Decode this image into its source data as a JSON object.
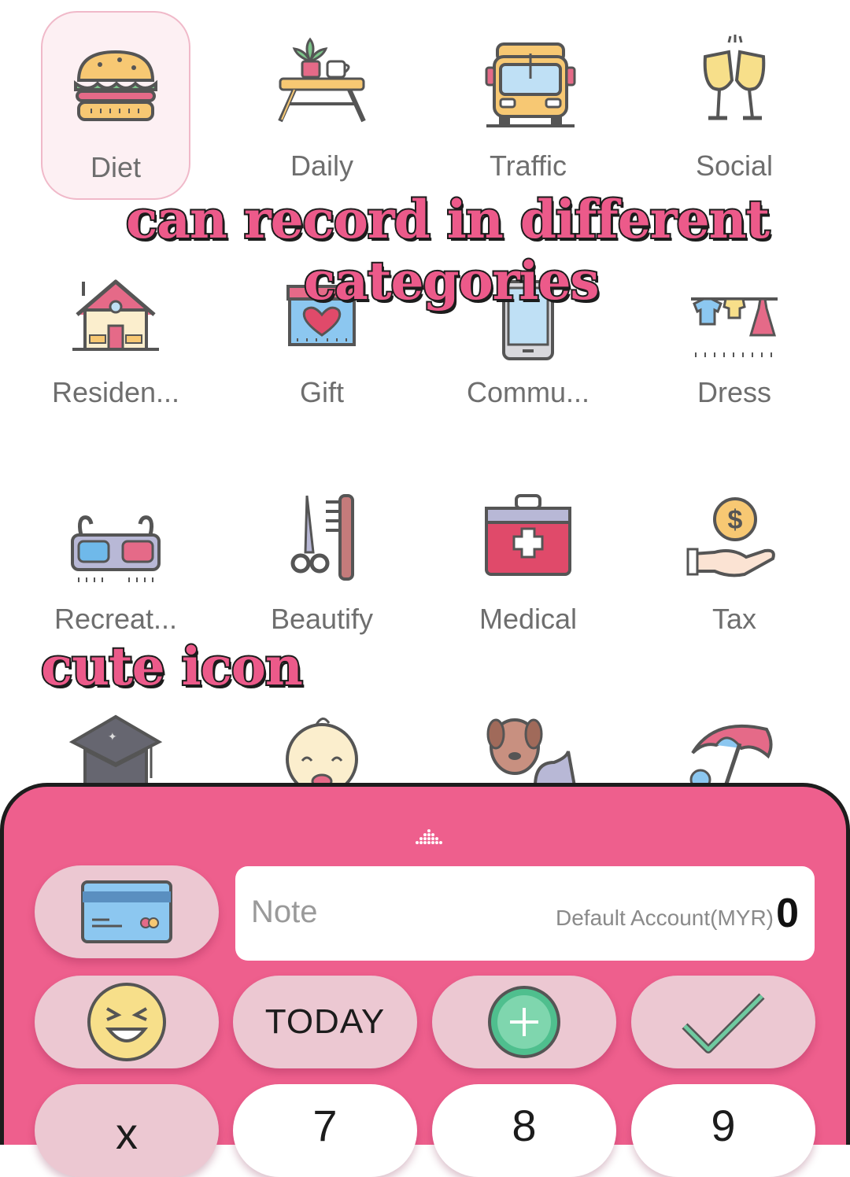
{
  "categories": [
    {
      "label": "Diet",
      "icon": "burger-icon",
      "selected": true
    },
    {
      "label": "Daily",
      "icon": "table-plant-icon"
    },
    {
      "label": "Traffic",
      "icon": "bus-icon"
    },
    {
      "label": "Social",
      "icon": "cheers-icon"
    },
    {
      "label": "Residen...",
      "icon": "house-icon"
    },
    {
      "label": "Gift",
      "icon": "gift-heart-icon"
    },
    {
      "label": "Commu...",
      "icon": "phone-icon"
    },
    {
      "label": "Dress",
      "icon": "clothesline-icon"
    },
    {
      "label": "Recreat...",
      "icon": "3d-glasses-icon"
    },
    {
      "label": "Beautify",
      "icon": "scissors-comb-icon"
    },
    {
      "label": "Medical",
      "icon": "first-aid-kit-icon"
    },
    {
      "label": "Tax",
      "icon": "coin-hand-icon"
    },
    {
      "label": "",
      "icon": "graduation-cap-icon"
    },
    {
      "label": "",
      "icon": "baby-icon"
    },
    {
      "label": "",
      "icon": "pets-icon"
    },
    {
      "label": "",
      "icon": "beach-umbrella-icon"
    }
  ],
  "captions": {
    "line1": "can record in different",
    "line2": "categories",
    "cute": "cute icon"
  },
  "input": {
    "note_placeholder": "Note",
    "account": "Default Account(MYR)",
    "amount": "0"
  },
  "keys": {
    "today": "TODAY",
    "row_keys": [
      "x",
      "7",
      "8",
      "9"
    ]
  },
  "colors": {
    "accent": "#ee5f8d",
    "key_bg": "#ecc8d2",
    "caption_fill": "#ec5a8a"
  }
}
